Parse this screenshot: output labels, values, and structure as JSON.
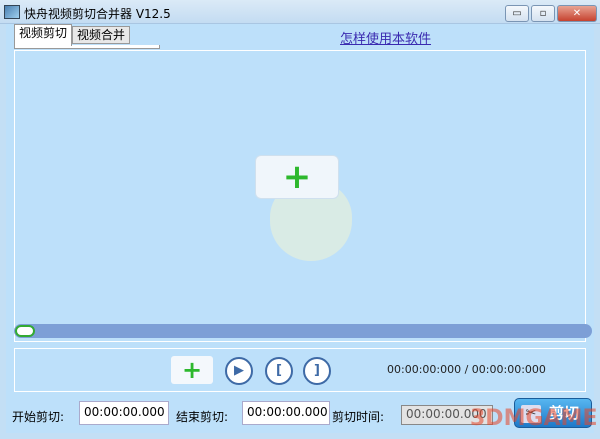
{
  "window": {
    "title": "快舟视频剪切合并器 V12.5",
    "minimize": "▭",
    "maximize": "▫",
    "close": "✕"
  },
  "tabs": [
    {
      "label": "视频剪切"
    },
    {
      "label": "视频合并"
    }
  ],
  "help_link": "怎样使用本软件",
  "preview": {
    "add_icon": "+"
  },
  "progress": {
    "value": 0
  },
  "controls": {
    "add_icon": "+",
    "play_icon": "▶",
    "mark_in_icon": "[",
    "mark_out_icon": "]",
    "time_position": "00:00:00:000 / 00:00:00:000"
  },
  "bottom": {
    "start_label": "开始剪切:",
    "start_value": "00:00:00.000",
    "end_label": "结束剪切:",
    "end_value": "00:00:00.000",
    "duration_label": "剪切时间:",
    "duration_value": "00:00:00.000",
    "cut_button": "剪切",
    "cut_icon": "✂"
  },
  "watermark": "3DMGAME"
}
